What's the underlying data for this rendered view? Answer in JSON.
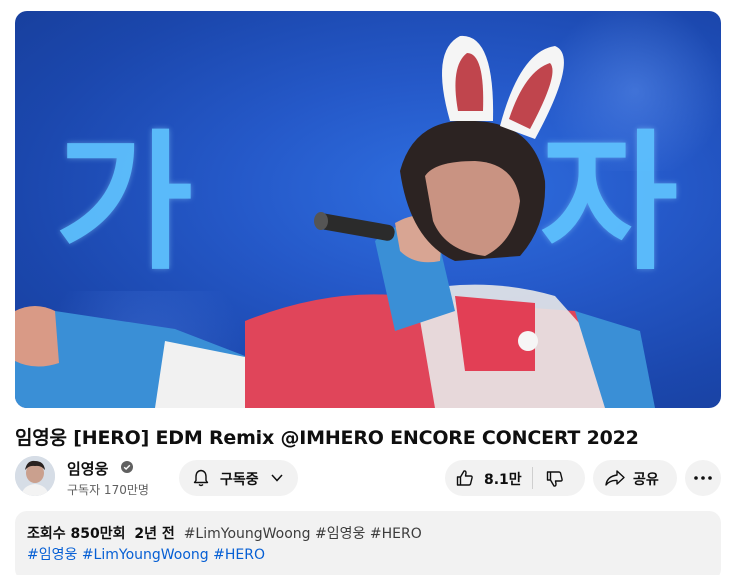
{
  "video": {
    "overlay_left": "가",
    "overlay_right": "자"
  },
  "title": "임영웅 [HERO] EDM Remix @IMHERO ENCORE CONCERT 2022",
  "channel": {
    "name": "임영웅",
    "subscribers": "구독자 170만명",
    "verified_icon": "verified-check-icon"
  },
  "actions": {
    "subscribe_label": "구독중",
    "like_count": "8.1만",
    "share_label": "공유"
  },
  "description": {
    "views": "조회수 850만회",
    "age": "2년 전",
    "tags_line1": [
      "#LimYoungWoong",
      "#임영웅",
      "#HERO"
    ],
    "tags_line2": [
      "#임영웅",
      "#LimYoungWoong",
      "#HERO"
    ]
  },
  "colors": {
    "link": "#065fd4",
    "pill_bg": "#f2f2f2",
    "overlay_text": "#5fc3ff"
  }
}
